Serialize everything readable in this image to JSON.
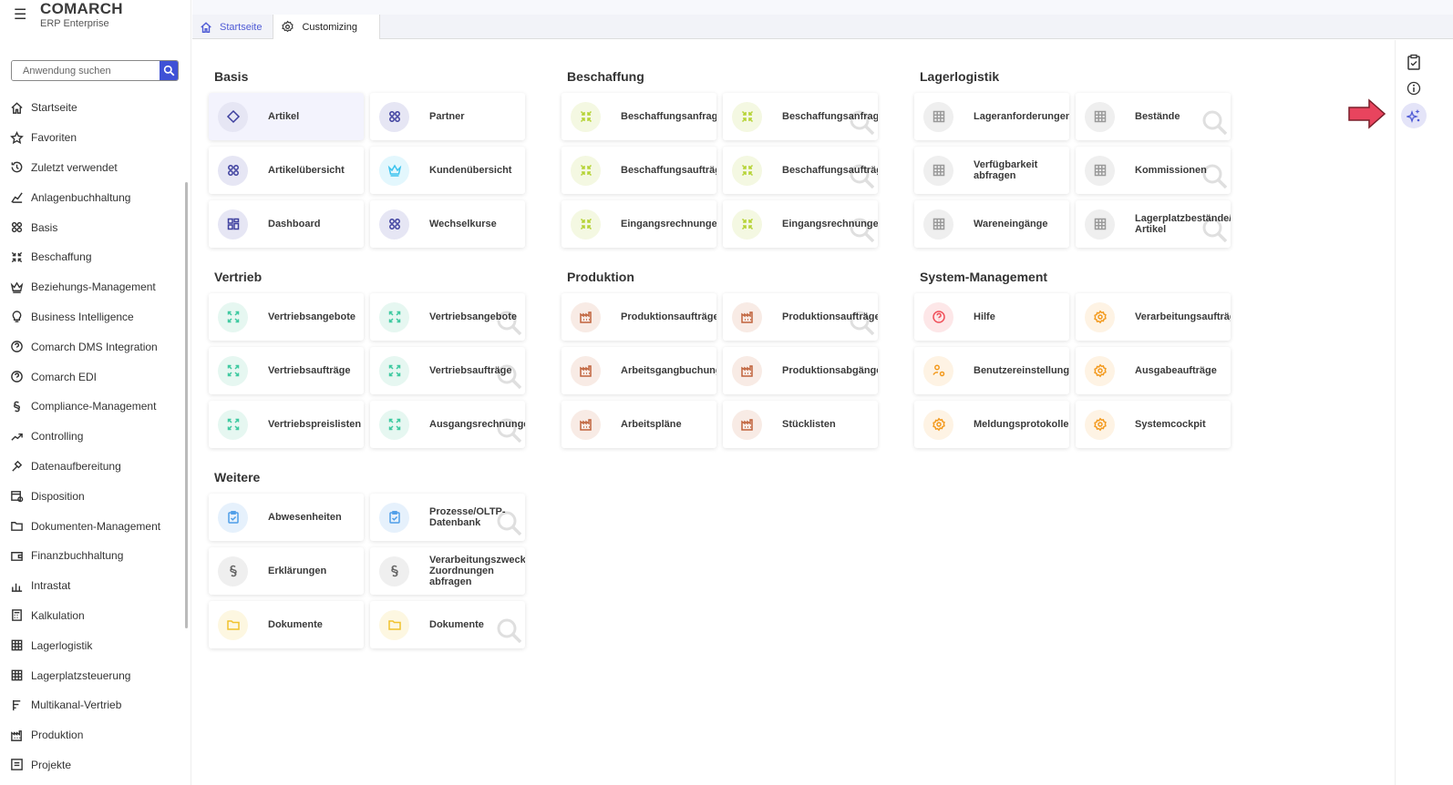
{
  "header": {
    "brand": "COMARCH",
    "product": "ERP Enterprise"
  },
  "search": {
    "placeholder": "Anwendung suchen"
  },
  "sidebar": {
    "items": [
      {
        "label": "Startseite",
        "icon": "home"
      },
      {
        "label": "Favoriten",
        "icon": "star"
      },
      {
        "label": "Zuletzt verwendet",
        "icon": "history"
      },
      {
        "label": "Anlagenbuchhaltung",
        "icon": "chart"
      },
      {
        "label": "Basis",
        "icon": "grid4"
      },
      {
        "label": "Beschaffung",
        "icon": "arrows"
      },
      {
        "label": "Beziehungs-Management",
        "icon": "crown"
      },
      {
        "label": "Business Intelligence",
        "icon": "bulb"
      },
      {
        "label": "Comarch DMS Integration",
        "icon": "help"
      },
      {
        "label": "Comarch EDI",
        "icon": "help"
      },
      {
        "label": "Compliance-Management",
        "icon": "para"
      },
      {
        "label": "Controlling",
        "icon": "trend"
      },
      {
        "label": "Datenaufbereitung",
        "icon": "tool"
      },
      {
        "label": "Disposition",
        "icon": "cal"
      },
      {
        "label": "Dokumenten-Management",
        "icon": "folder"
      },
      {
        "label": "Finanzbuchhaltung",
        "icon": "fin"
      },
      {
        "label": "Intrastat",
        "icon": "bars"
      },
      {
        "label": "Kalkulation",
        "icon": "calc"
      },
      {
        "label": "Lagerlogistik",
        "icon": "table"
      },
      {
        "label": "Lagerplatzsteuerung",
        "icon": "table"
      },
      {
        "label": "Multikanal-Vertrieb",
        "icon": "multi"
      },
      {
        "label": "Produktion",
        "icon": "factory"
      },
      {
        "label": "Projekte",
        "icon": "proj"
      }
    ]
  },
  "tabs": [
    {
      "label": "Startseite",
      "icon": "home"
    },
    {
      "label": "Customizing",
      "icon": "gear"
    }
  ],
  "colors": {
    "accent": "#3f51d6",
    "basis": "#3d3f9e",
    "vertrieb": "#3ec9a0",
    "beschaffung": "#b5d334",
    "produktion": "#c0633c",
    "lager": "#9a9a9a",
    "system": "#f39a1e",
    "hilfe": "#f0505a",
    "weitere": "#4f9ee8",
    "arrow": "#e8445e"
  },
  "sections": [
    {
      "title": "Basis",
      "col": 0,
      "row": 0,
      "cards": [
        {
          "label": "Artikel",
          "icon": "diamond",
          "tone": "basis",
          "selected": true
        },
        {
          "label": "Partner",
          "icon": "grid4",
          "tone": "basis"
        },
        {
          "label": "Artikelübersicht",
          "icon": "grid4",
          "tone": "basis"
        },
        {
          "label": "Kundenübersicht",
          "icon": "crown",
          "tone": "crown"
        },
        {
          "label": "Dashboard",
          "icon": "dash",
          "tone": "basis"
        },
        {
          "label": "Wechselkurse",
          "icon": "grid4",
          "tone": "basis"
        }
      ]
    },
    {
      "title": "Beschaffung",
      "col": 1,
      "row": 0,
      "cards": [
        {
          "label": "Beschaffungsanfragen",
          "icon": "arrows",
          "tone": "beschaffung"
        },
        {
          "label": "Beschaffungsanfragen",
          "icon": "arrows",
          "tone": "beschaffung",
          "hint": true
        },
        {
          "label": "Beschaffungsaufträge",
          "icon": "arrows",
          "tone": "beschaffung"
        },
        {
          "label": "Beschaffungsaufträge",
          "icon": "arrows",
          "tone": "beschaffung",
          "hint": true
        },
        {
          "label": "Eingangsrechnungen",
          "icon": "arrows",
          "tone": "beschaffung"
        },
        {
          "label": "Eingangsrechnungen",
          "icon": "arrows",
          "tone": "beschaffung",
          "hint": true
        }
      ]
    },
    {
      "title": "Lagerlogistik",
      "col": 2,
      "row": 0,
      "cards": [
        {
          "label": "Lageranforderungen",
          "icon": "table",
          "tone": "lager"
        },
        {
          "label": "Bestände",
          "icon": "table",
          "tone": "lager",
          "hint": true
        },
        {
          "label": "Verfügbarkeit abfragen",
          "icon": "table",
          "tone": "lager"
        },
        {
          "label": "Kommissionen",
          "icon": "table",
          "tone": "lager",
          "hint": true
        },
        {
          "label": "Wareneingänge",
          "icon": "table",
          "tone": "lager"
        },
        {
          "label": "Lagerplatzbestände/ Artikel",
          "icon": "table",
          "tone": "lager",
          "hint": true
        }
      ]
    },
    {
      "title": "Vertrieb",
      "col": 0,
      "row": 1,
      "cards": [
        {
          "label": "Vertriebsangebote",
          "icon": "expand",
          "tone": "vertrieb"
        },
        {
          "label": "Vertriebsangebote",
          "icon": "expand",
          "tone": "vertrieb",
          "hint": true
        },
        {
          "label": "Vertriebsaufträge",
          "icon": "expand",
          "tone": "vertrieb"
        },
        {
          "label": "Vertriebsaufträge",
          "icon": "expand",
          "tone": "vertrieb",
          "hint": true
        },
        {
          "label": "Vertriebspreislisten",
          "icon": "expand",
          "tone": "vertrieb"
        },
        {
          "label": "Ausgangsrechnungen",
          "icon": "expand",
          "tone": "vertrieb",
          "hint": true
        }
      ]
    },
    {
      "title": "Produktion",
      "col": 1,
      "row": 1,
      "cards": [
        {
          "label": "Produktionsaufträge",
          "icon": "factory",
          "tone": "produktion"
        },
        {
          "label": "Produktionsaufträge",
          "icon": "factory",
          "tone": "produktion",
          "hint": true
        },
        {
          "label": "Arbeitsgangbuchungen",
          "icon": "factory",
          "tone": "produktion"
        },
        {
          "label": "Produktionsabgänge",
          "icon": "factory",
          "tone": "produktion"
        },
        {
          "label": "Arbeitspläne",
          "icon": "factory",
          "tone": "produktion"
        },
        {
          "label": "Stücklisten",
          "icon": "factory",
          "tone": "produktion"
        }
      ]
    },
    {
      "title": "System-Management",
      "col": 2,
      "row": 1,
      "cards": [
        {
          "label": "Hilfe",
          "icon": "help",
          "tone": "hilfe"
        },
        {
          "label": "Verarbeitungsaufträge",
          "icon": "gear",
          "tone": "system"
        },
        {
          "label": "Benutzereinstellungen",
          "icon": "usergear",
          "tone": "system"
        },
        {
          "label": "Ausgabeaufträge",
          "icon": "gear",
          "tone": "system"
        },
        {
          "label": "Meldungsprotokolle",
          "icon": "gear",
          "tone": "system"
        },
        {
          "label": "Systemcockpit",
          "icon": "gear",
          "tone": "system"
        }
      ]
    },
    {
      "title": "Weitere",
      "col": 0,
      "row": 2,
      "cards": [
        {
          "label": "Abwesenheiten",
          "icon": "clip",
          "tone": "weitere"
        },
        {
          "label": "Prozesse/OLTP-Datenbank",
          "icon": "clip",
          "tone": "weitere",
          "hint": true
        },
        {
          "label": "Erklärungen",
          "icon": "para",
          "tone": "lager2"
        },
        {
          "label": "Verarbeitungszweck-Zuordnungen abfragen",
          "icon": "para",
          "tone": "lager2"
        },
        {
          "label": "Dokumente",
          "icon": "folder",
          "tone": "folder"
        },
        {
          "label": "Dokumente",
          "icon": "folder",
          "tone": "folder",
          "hint": true
        }
      ]
    }
  ]
}
